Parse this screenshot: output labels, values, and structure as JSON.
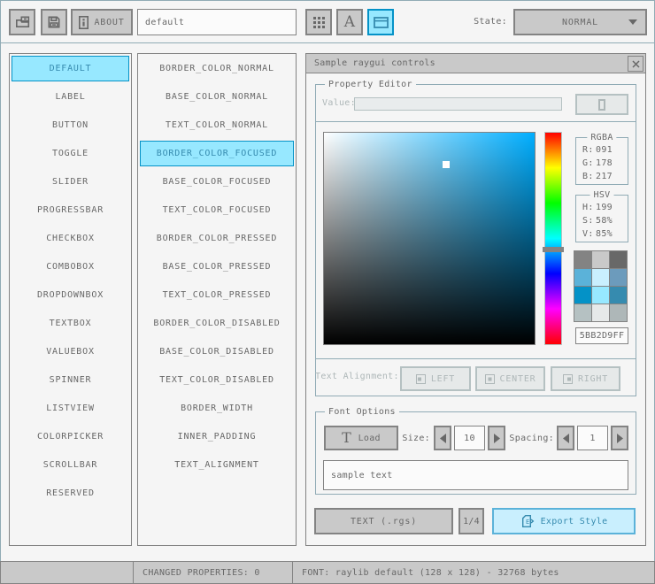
{
  "toolbar": {
    "style_name": "default",
    "about_label": "ABOUT",
    "state_label": "State:",
    "state_value": "NORMAL"
  },
  "controls_list": {
    "selected": "DEFAULT",
    "items": [
      "DEFAULT",
      "LABEL",
      "BUTTON",
      "TOGGLE",
      "SLIDER",
      "PROGRESSBAR",
      "CHECKBOX",
      "COMBOBOX",
      "DROPDOWNBOX",
      "TEXTBOX",
      "VALUEBOX",
      "SPINNER",
      "LISTVIEW",
      "COLORPICKER",
      "SCROLLBAR",
      "RESERVED"
    ]
  },
  "properties_list": {
    "selected": "BORDER_COLOR_FOCUSED",
    "items": [
      "BORDER_COLOR_NORMAL",
      "BASE_COLOR_NORMAL",
      "TEXT_COLOR_NORMAL",
      "BORDER_COLOR_FOCUSED",
      "BASE_COLOR_FOCUSED",
      "TEXT_COLOR_FOCUSED",
      "BORDER_COLOR_PRESSED",
      "BASE_COLOR_PRESSED",
      "TEXT_COLOR_PRESSED",
      "BORDER_COLOR_DISABLED",
      "BASE_COLOR_DISABLED",
      "TEXT_COLOR_DISABLED",
      "BORDER_WIDTH",
      "INNER_PADDING",
      "TEXT_ALIGNMENT"
    ]
  },
  "sample_window": {
    "title": "Sample raygui controls",
    "property_editor": {
      "title": "Property Editor",
      "value_label": "Value:",
      "value_text": "",
      "rgba": {
        "title": "RGBA",
        "rows": [
          {
            "label": "R:",
            "value": "091"
          },
          {
            "label": "G:",
            "value": "178"
          },
          {
            "label": "B:",
            "value": "217"
          }
        ]
      },
      "hsv": {
        "title": "HSV",
        "rows": [
          {
            "label": "H:",
            "value": "199"
          },
          {
            "label": "S:",
            "value": "58%"
          },
          {
            "label": "V:",
            "value": "85%"
          }
        ]
      },
      "hex_value": "5BB2D9FF",
      "text_alignment_label": "Text Alignment:",
      "alignment_buttons": [
        "LEFT",
        "CENTER",
        "RIGHT"
      ]
    },
    "font_options": {
      "title": "Font Options",
      "load_label": "Load",
      "size_label": "Size:",
      "size_value": "10",
      "spacing_label": "Spacing:",
      "spacing_value": "1",
      "sample_text": "sample text"
    },
    "export_row": {
      "format_label": "TEXT (.rgs)",
      "pager_label": "1/4",
      "export_label": "Export Style"
    }
  },
  "statusbar": {
    "changed_properties": "CHANGED PROPERTIES: 0",
    "font_info": "FONT: raylib default (128 x 128) - 32768 bytes"
  },
  "color_picker": {
    "hue": 199,
    "saturation_pct": 58,
    "value_pct": 85
  },
  "style_grid_colors": [
    "#838383",
    "#c9c9c9",
    "#686868",
    "#5bb2d9",
    "#c9effe",
    "#6c9bbc",
    "#0492c7",
    "#97e8ff",
    "#368baf",
    "#b5c1c2",
    "#e6e9e9",
    "#aeb7b8"
  ],
  "palette": {
    "background": "#f5f5f5",
    "border_normal": "#838383",
    "base_normal": "#c9c9c9",
    "text_normal": "#686868",
    "border_focused": "#5bb2d9",
    "base_focused": "#c9effe",
    "text_focused": "#6c9bbc",
    "border_pressed": "#0492c7",
    "base_pressed": "#97e8ff",
    "text_pressed": "#368baf",
    "border_disabled": "#b5c1c2",
    "base_disabled": "#e6e9e9",
    "text_disabled": "#aeb7b8",
    "line": "#90abb5"
  }
}
